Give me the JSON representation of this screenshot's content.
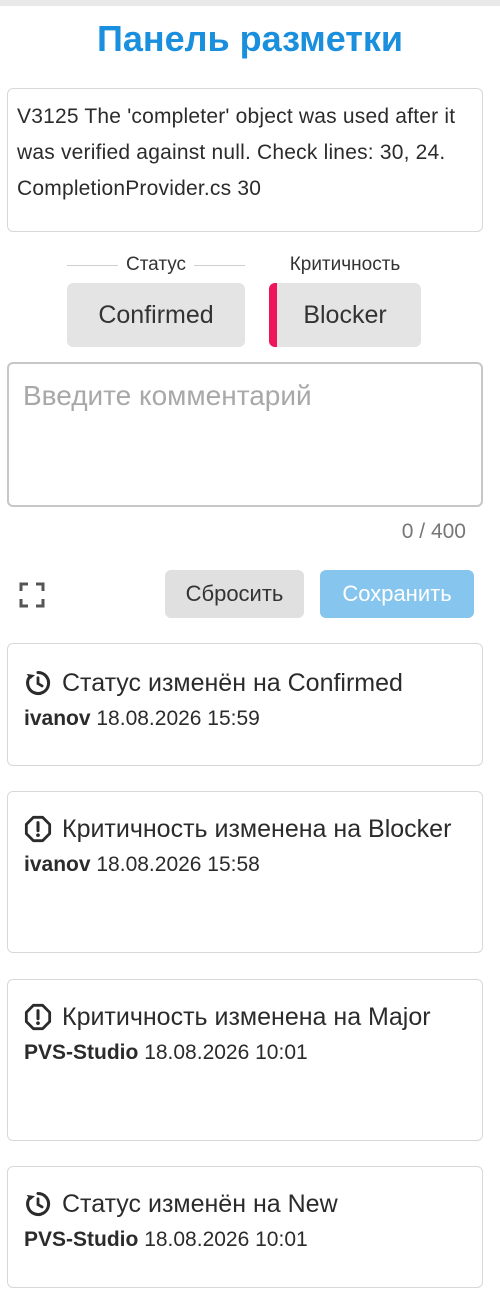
{
  "panel": {
    "title": "Панель разметки"
  },
  "warning": {
    "message": "V3125 The 'completer' object was used after it was verified against null. Check lines: 30, 24. CompletionProvider.cs 30"
  },
  "status": {
    "label": "Статус",
    "value": "Confirmed"
  },
  "severity": {
    "label": "Критичность",
    "value": "Blocker",
    "accent_color": "#f0145a"
  },
  "comment": {
    "placeholder": "Введите комментарий",
    "value": "",
    "counter": "0 / 400"
  },
  "actions": {
    "reset_label": "Сбросить",
    "save_label": "Сохранить"
  },
  "colors": {
    "title": "#1a8fdd",
    "save_button": "#86c6ee"
  },
  "history": [
    {
      "icon": "history-icon",
      "text": "Статус изменён на Confirmed",
      "user": "ivanov",
      "timestamp": "18.08.2026 15:59"
    },
    {
      "icon": "alert-octagon-icon",
      "text": "Критичность изменена на Blocker",
      "user": "ivanov",
      "timestamp": "18.08.2026 15:58"
    },
    {
      "icon": "alert-octagon-icon",
      "text": "Критичность изменена на Major",
      "user": "PVS-Studio",
      "timestamp": "18.08.2026 10:01"
    },
    {
      "icon": "history-icon",
      "text": "Статус изменён на New",
      "user": "PVS-Studio",
      "timestamp": "18.08.2026 10:01"
    }
  ]
}
